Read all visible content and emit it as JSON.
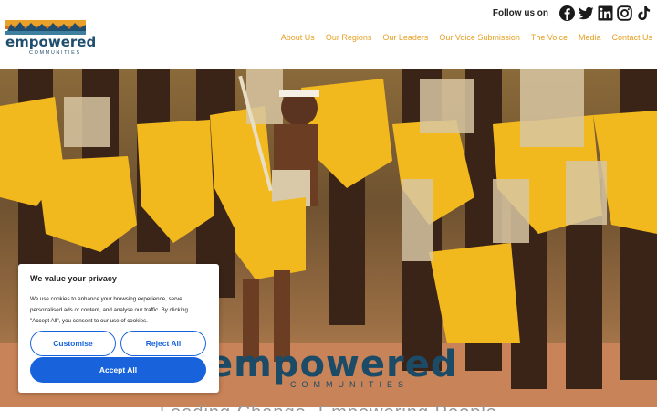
{
  "header": {
    "logo": {
      "word": "empowered",
      "sub": "COMMUNITIES"
    },
    "follow_label": "Follow us on",
    "social": [
      {
        "name": "facebook-icon"
      },
      {
        "name": "twitter-icon"
      },
      {
        "name": "linkedin-icon"
      },
      {
        "name": "instagram-icon"
      },
      {
        "name": "tiktok-icon"
      }
    ],
    "nav": [
      "About Us",
      "Our Regions",
      "Our Leaders",
      "Our Voice Submission",
      "The Voice",
      "Media",
      "Contact Us"
    ]
  },
  "hero": {
    "brand_word": "empowered",
    "brand_sub": "COMMUNITIES",
    "subline": "Leading Change, Empowering People"
  },
  "cookie": {
    "title": "We value your privacy",
    "text": "We use cookies to enhance your browsing experience, serve personalised ads or content, and analyse our traffic. By clicking \"Accept All\", you consent to our use of cookies.",
    "customise_label": "Customise",
    "reject_label": "Reject All",
    "accept_label": "Accept All"
  },
  "colors": {
    "nav": "#e6a023",
    "brand_blue": "#1b4b66",
    "button_blue": "#1863dc"
  }
}
